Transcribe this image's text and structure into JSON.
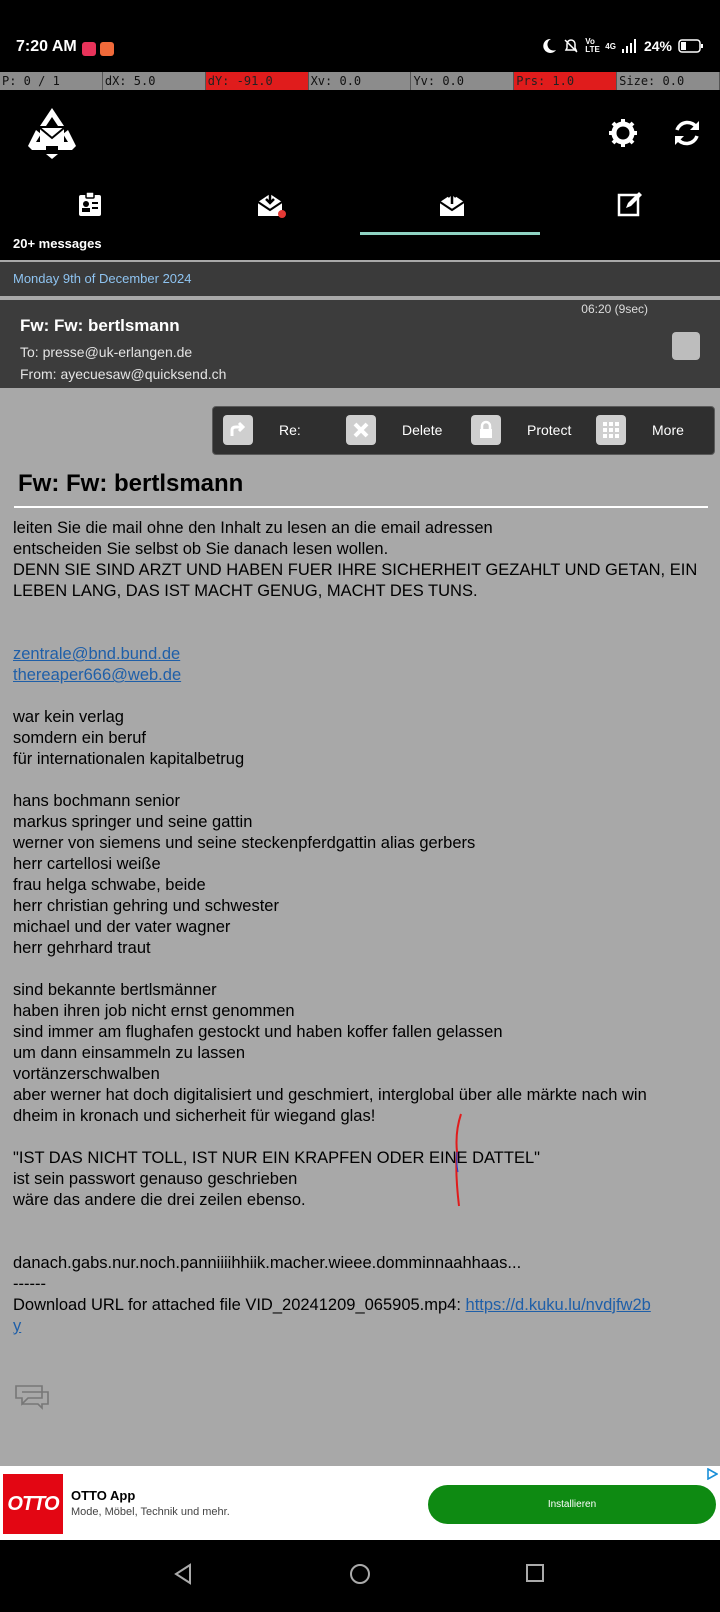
{
  "status_bar": {
    "time": "7:20 AM",
    "volte_label": "Vo LTE",
    "network_label": "4G",
    "battery": "24%"
  },
  "pointer_bar": [
    "P: 0 / 1",
    "dX: 5.0",
    "dY: -91.0",
    "Xv: 0.0",
    "Yv: 0.0",
    "Prs: 1.0",
    "Size: 0.0"
  ],
  "header": {
    "message_count": "20+ messages",
    "tabs": [
      "contacts",
      "inbox",
      "sent",
      "compose"
    ],
    "active_tab": "sent"
  },
  "date_bar": "Monday 9th of December 2024",
  "mail_card": {
    "subject": "Fw: Fw: bertlsmann",
    "to": "To: presse@uk-erlangen.de",
    "from": "From: ayecuesaw@quicksend.ch",
    "time": "06:20 (9sec)"
  },
  "actions": {
    "reply": "Re:",
    "delete": "Delete",
    "protect": "Protect",
    "more": "More"
  },
  "email": {
    "subject": "Fw: Fw: bertlsmann",
    "lines": [
      "leiten Sie die mail ohne den Inhalt zu lesen an die email adressen",
      "entscheiden Sie selbst ob Sie danach lesen wollen.",
      "DENN SIE SIND ARZT UND HABEN FUER IHRE SICHERHEIT GEZAHLT UND GETAN, EIN",
      "LEBEN LANG, DAS IST MACHT GENUG, MACHT DES TUNS.",
      "",
      "",
      "zentrale@bnd.bund.de",
      "thereaper666@web.de",
      "",
      "war kein verlag",
      "somdern ein beruf",
      "für internationalen kapitalbetrug",
      "",
      "hans bochmann senior",
      "markus springer und seine gattin",
      "werner von siemens und seine steckenpferdgattin alias gerbers",
      "herr cartellosi weiße",
      "frau helga schwabe, beide",
      "herr christian gehring und schwester",
      "michael und der vater wagner",
      "herr gehrhard traut",
      "",
      "sind bekannte bertlsmänner",
      "haben ihren job nicht ernst genommen",
      "sind immer am flughafen gestockt und haben koffer fallen gelassen",
      "um dann einsammeln zu lassen",
      "vortänzerschwalben",
      "aber werner hat doch digitalisiert und geschmiert, interglobal über alle märkte nach win",
      "dheim in kronach und sicherheit für wiegand glas!",
      "",
      "\"IST DAS NICHT TOLL, IST NUR EIN KRAPFEN ODER EINE DATTEL\"",
      "ist sein passwort genauso geschrieben",
      "wäre das andere die drei zeilen ebenso.",
      "",
      "",
      "danach.gabs.nur.noch.panniiiihhiik.macher.wieee.domminnaahhaas...",
      "------",
      "Download URL for attached file VID_20241209_065905.mp4: ",
      "y"
    ],
    "link_lines": [
      6,
      7
    ],
    "download_link": "https://d.kuku.lu/nvdjfw2b"
  },
  "ad": {
    "logo_text": "OTTO",
    "title": "OTTO App",
    "subtitle": "Mode, Möbel, Technik und mehr.",
    "button": "Installieren"
  },
  "colors": {
    "header_bg": "#000000",
    "accent_underline": "#8fd3c3",
    "date_text": "#8ec3f0",
    "body_bg": "#a8a8a8",
    "link": "#1f5fa8",
    "ad_button": "#0e8a12",
    "pointer_hot": "#e01c1c"
  },
  "icons": [
    "recycle-mail-icon",
    "gear-icon",
    "refresh-icon",
    "contacts-icon",
    "inbox-icon",
    "sent-icon",
    "compose-icon",
    "reply-icon",
    "delete-icon",
    "lock-icon",
    "grid-icon",
    "conversation-icon"
  ]
}
